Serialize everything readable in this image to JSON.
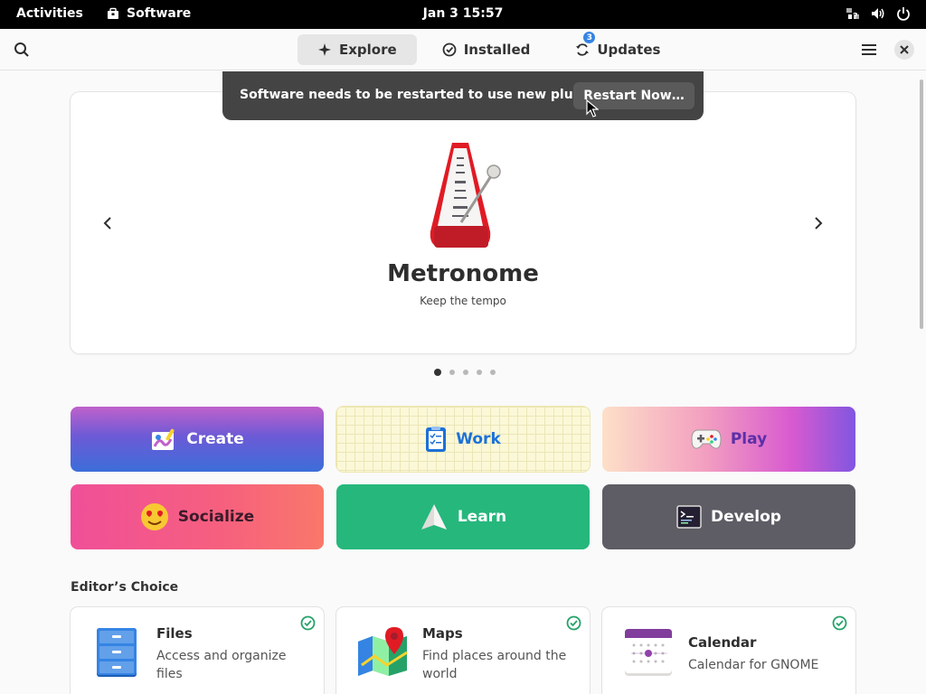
{
  "topbar": {
    "activities": "Activities",
    "app_name": "Software",
    "clock": "Jan 3  15:57"
  },
  "header": {
    "tabs": [
      {
        "label": "Explore",
        "icon": "star-icon"
      },
      {
        "label": "Installed",
        "icon": "check-circle-icon"
      },
      {
        "label": "Updates",
        "icon": "refresh-icon",
        "badge": "3"
      }
    ],
    "active_tab": "Explore"
  },
  "banner": {
    "message": "Software needs to be restarted to use new plugins.",
    "button": "Restart Now…"
  },
  "featured": {
    "title": "Metronome",
    "subtitle": "Keep the tempo",
    "page_count": 5,
    "active_page": 1
  },
  "categories": [
    {
      "label": "Create",
      "icon": "paint-brush-icon"
    },
    {
      "label": "Work",
      "icon": "clipboard-icon"
    },
    {
      "label": "Play",
      "icon": "gamepad-icon"
    },
    {
      "label": "Socialize",
      "icon": "heart-eyes-emoji-icon"
    },
    {
      "label": "Learn",
      "icon": "paper-plane-icon"
    },
    {
      "label": "Develop",
      "icon": "terminal-icon"
    }
  ],
  "editors_choice": {
    "title": "Editor’s Choice",
    "apps": [
      {
        "name": "Files",
        "description": "Access and organize files",
        "installed": true,
        "icon": "file-cabinet-icon"
      },
      {
        "name": "Maps",
        "description": "Find places around the world",
        "installed": true,
        "icon": "map-pin-icon"
      },
      {
        "name": "Calendar",
        "description": "Calendar for GNOME",
        "installed": true,
        "icon": "calendar-icon"
      }
    ]
  },
  "colors": {
    "accent": "#3584e4",
    "installed_check": "#26a269",
    "banner_bg": "#444444"
  }
}
